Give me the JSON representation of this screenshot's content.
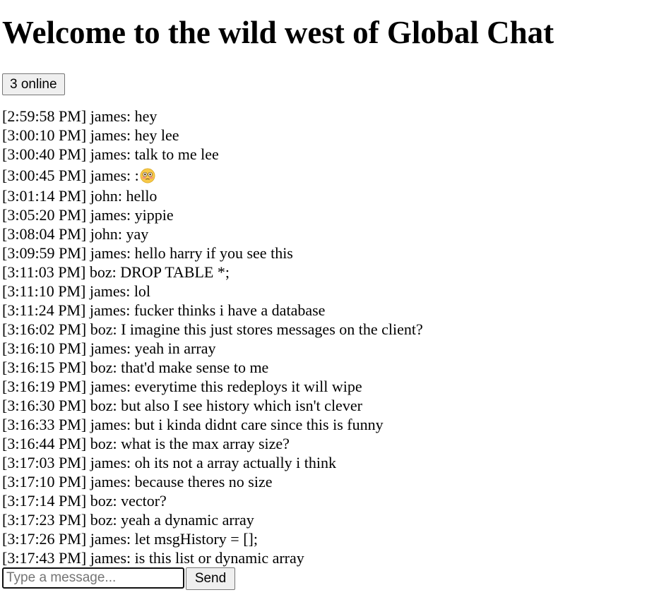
{
  "page": {
    "title": "Welcome to the wild west of Global Chat"
  },
  "status": {
    "online_label": "3 online"
  },
  "messages": [
    {
      "time": "[2:59:58 PM]",
      "user": "james",
      "text": "hey"
    },
    {
      "time": "[3:00:10 PM]",
      "user": "james",
      "text": "hey lee"
    },
    {
      "time": "[3:00:40 PM]",
      "user": "james",
      "text": "talk to me lee"
    },
    {
      "time": "[3:00:45 PM]",
      "user": "james",
      "text": ":",
      "emoji": "flushed-face-emoji"
    },
    {
      "time": "[3:01:14 PM]",
      "user": "john",
      "text": "hello"
    },
    {
      "time": "[3:05:20 PM]",
      "user": "james",
      "text": "yippie"
    },
    {
      "time": "[3:08:04 PM]",
      "user": "john",
      "text": "yay"
    },
    {
      "time": "[3:09:59 PM]",
      "user": "james",
      "text": "hello harry if you see this"
    },
    {
      "time": "[3:11:03 PM]",
      "user": "boz",
      "text": "DROP TABLE *;"
    },
    {
      "time": "[3:11:10 PM]",
      "user": "james",
      "text": "lol"
    },
    {
      "time": "[3:11:24 PM]",
      "user": "james",
      "text": "fucker thinks i have a database"
    },
    {
      "time": "[3:16:02 PM]",
      "user": "boz",
      "text": "I imagine this just stores messages on the client?"
    },
    {
      "time": "[3:16:10 PM]",
      "user": "james",
      "text": "yeah in array"
    },
    {
      "time": "[3:16:15 PM]",
      "user": "boz",
      "text": "that'd make sense to me"
    },
    {
      "time": "[3:16:19 PM]",
      "user": "james",
      "text": "everytime this redeploys it will wipe"
    },
    {
      "time": "[3:16:30 PM]",
      "user": "boz",
      "text": "but also I see history which isn't clever"
    },
    {
      "time": "[3:16:33 PM]",
      "user": "james",
      "text": "but i kinda didnt care since this is funny"
    },
    {
      "time": "[3:16:44 PM]",
      "user": "boz",
      "text": "what is the max array size?"
    },
    {
      "time": "[3:17:03 PM]",
      "user": "james",
      "text": "oh its not a array actually i think"
    },
    {
      "time": "[3:17:10 PM]",
      "user": "james",
      "text": "because theres no size"
    },
    {
      "time": "[3:17:14 PM]",
      "user": "boz",
      "text": "vector?"
    },
    {
      "time": "[3:17:23 PM]",
      "user": "boz",
      "text": "yeah a dynamic array"
    },
    {
      "time": "[3:17:26 PM]",
      "user": "james",
      "text": "let msgHistory = [];"
    },
    {
      "time": "[3:17:43 PM]",
      "user": "james",
      "text": "is this list or dynamic array"
    }
  ],
  "composer": {
    "placeholder": "Type a message...",
    "value": "",
    "send_label": "Send"
  }
}
